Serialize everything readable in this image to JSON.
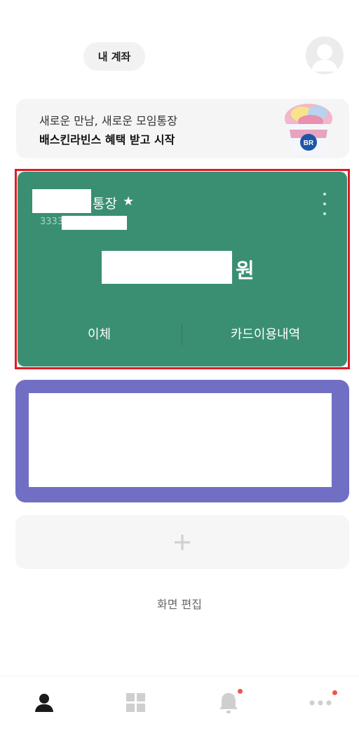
{
  "header": {
    "my_account_label": "내 계좌",
    "avatar_icon": "user-silhouette-icon"
  },
  "promo": {
    "line1": "새로운 만남, 새로운 모임통장",
    "line2": "배스킨라빈스 혜택 받고 시작",
    "image": "baskin-robbins-ice-cream-cup",
    "cup_label": "BR"
  },
  "account_card": {
    "type_label": "통장",
    "star": "★",
    "number_prefix": "3333",
    "currency": "원",
    "actions": [
      "이체",
      "카드이용내역"
    ],
    "color": "#3a8f73",
    "highlight_color": "#e01a22"
  },
  "second_card": {
    "color": "#716fc3"
  },
  "add_tile": {
    "icon": "plus-icon"
  },
  "edit_screen_label": "화면 편집",
  "bottom_nav": {
    "items": [
      {
        "icon": "person-icon",
        "active": true
      },
      {
        "icon": "grid-menu-icon",
        "active": false
      },
      {
        "icon": "bell-icon",
        "active": false,
        "badge": true
      },
      {
        "icon": "more-dots-icon",
        "active": false,
        "badge": true
      }
    ],
    "badge_color": "#f0564a"
  }
}
